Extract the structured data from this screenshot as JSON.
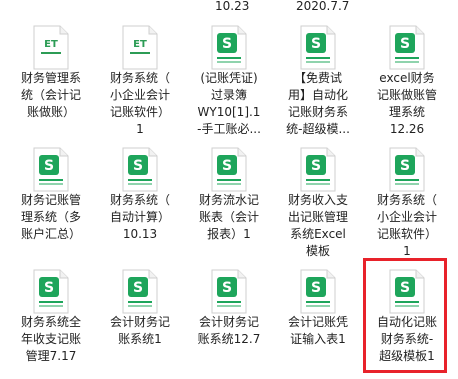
{
  "top_labels": [
    "10.23",
    "2020.7.7"
  ],
  "colors": {
    "sheet_green": "#1ea55b",
    "et_green": "#2c9c55",
    "selection": "#e8222a"
  },
  "files": [
    {
      "name": "财务管理系\n统（会计记\n账做账）",
      "icon": "et-file-icon"
    },
    {
      "name": "财务系统（\n小企业会计\n记账软件）\n1",
      "icon": "et-file-icon"
    },
    {
      "name": "(记账凭证)\n过录簿\nWY10[1].1\n-手工账必...",
      "icon": "spreadsheet-file-icon"
    },
    {
      "name": "【免费试\n用】自动化\n记账财务系\n统-超级模...",
      "icon": "spreadsheet-file-icon"
    },
    {
      "name": "excel财务\n记账做账管\n理系统\n12.26",
      "icon": "spreadsheet-file-icon"
    },
    {
      "name": "财务记账管\n理系统（多\n账户汇总）",
      "icon": "spreadsheet-file-icon"
    },
    {
      "name": "财务系统（\n自动计算）\n10.13",
      "icon": "spreadsheet-file-icon"
    },
    {
      "name": "财务流水记\n账表（会计\n报表）1",
      "icon": "spreadsheet-file-icon"
    },
    {
      "name": "财务收入支\n出记账管理\n系统Excel\n模板",
      "icon": "spreadsheet-file-icon"
    },
    {
      "name": "财务系统（\n小企业会计\n记账软件）\n1",
      "icon": "spreadsheet-file-icon"
    },
    {
      "name": "财务系统全\n年收支记账\n管理7.17",
      "icon": "spreadsheet-file-icon"
    },
    {
      "name": "会计财务记\n账系统1",
      "icon": "spreadsheet-file-icon"
    },
    {
      "name": "会计财务记\n账系统12.7",
      "icon": "spreadsheet-file-icon"
    },
    {
      "name": "会计记账凭\n证输入表1",
      "icon": "spreadsheet-file-icon"
    },
    {
      "name": "自动化记账\n财务系统-\n超级模板1",
      "icon": "spreadsheet-file-icon",
      "selected": true
    }
  ]
}
